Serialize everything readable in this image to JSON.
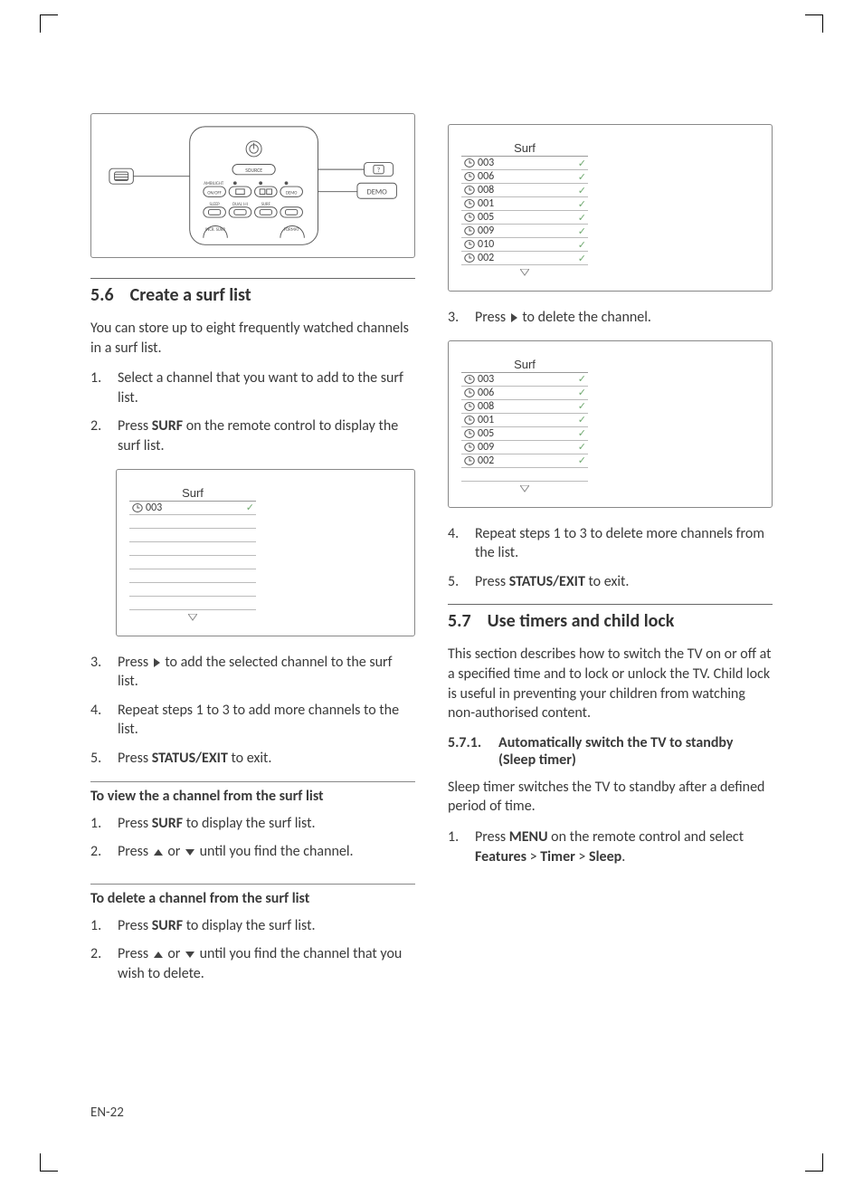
{
  "footer": "EN-22",
  "remote": {
    "source_label": "SOURCE",
    "demo_label": "DEMO",
    "ambilight": "AMBILIGHT",
    "onoff": "ON/OFF",
    "sleep": "SLEEP",
    "dual": "DUAL I-II",
    "surf": "SURF",
    "incr": "INCR. SURR",
    "format": "FORMAT"
  },
  "section56": {
    "number": "5.6",
    "title": "Create a surf list",
    "intro": "You can store up to eight frequently watched channels in a surf list.",
    "steps1": [
      {
        "n": "1.",
        "text_a": "Select a channel that you want to add to the surf list."
      },
      {
        "n": "2.",
        "text_a": "Press ",
        "bold": "SURF",
        "text_b": " on the remote control to display the surf list."
      }
    ],
    "surf1": {
      "title": "Surf",
      "rows": [
        "003"
      ]
    },
    "steps2": [
      {
        "n": "3.",
        "text_a": "Press ",
        "tri": "right",
        "text_b": " to add the selected channel to the surf list."
      },
      {
        "n": "4.",
        "text_a": "Repeat steps 1 to 3 to add more channels to the list."
      },
      {
        "n": "5.",
        "text_a": "Press ",
        "bold": "STATUS/EXIT",
        "text_b": " to exit."
      }
    ],
    "view": {
      "heading": "To view the a channel from the surf list",
      "steps": [
        {
          "n": "1.",
          "text_a": "Press ",
          "bold": "SURF",
          "text_b": " to display the surf list."
        },
        {
          "n": "2.",
          "text_a": "Press ",
          "tri": "up",
          "mid": " or ",
          "tri2": "down",
          "text_b": " until you find the channel."
        }
      ]
    },
    "delete": {
      "heading": "To delete a channel from the surf list",
      "steps": [
        {
          "n": "1.",
          "text_a": "Press ",
          "bold": "SURF",
          "text_b": " to display the surf list."
        },
        {
          "n": "2.",
          "text_a": "Press ",
          "tri": "up",
          "mid": " or ",
          "tri2": "down",
          "text_b": " until you find the channel that you wish to delete."
        }
      ]
    }
  },
  "rightcol": {
    "surf_full": {
      "title": "Surf",
      "rows": [
        "003",
        "006",
        "008",
        "001",
        "005",
        "009",
        "010",
        "002"
      ]
    },
    "step3": {
      "n": "3.",
      "text_a": "Press ",
      "tri": "right",
      "text_b": " to delete the channel."
    },
    "surf_after": {
      "title": "Surf",
      "rows": [
        "003",
        "006",
        "008",
        "001",
        "005",
        "009",
        "002"
      ]
    },
    "steps45": [
      {
        "n": "4.",
        "text_a": "Repeat steps 1 to 3 to delete more channels from the list."
      },
      {
        "n": "5.",
        "text_a": "Press ",
        "bold": "STATUS/EXIT",
        "text_b": " to exit."
      }
    ]
  },
  "section57": {
    "number": "5.7",
    "title": "Use timers and child lock",
    "intro": "This section describes how to switch the TV on or off at a specified time and to lock or unlock the TV. Child lock is useful in preventing your children from watching non-authorised content.",
    "sub571": {
      "number": "5.7.1.",
      "title": "Automatically switch the TV to standby (Sleep timer)",
      "intro": "Sleep timer switches the TV to standby after a defined period of time.",
      "step1": {
        "n": "1.",
        "text_a": "Press ",
        "bold1": "MENU",
        "text_b": " on the remote control and select ",
        "bold2": "Features",
        "sep1": " > ",
        "bold3": "Timer",
        "sep2": " > ",
        "bold4": "Sleep",
        "text_c": "."
      }
    }
  }
}
